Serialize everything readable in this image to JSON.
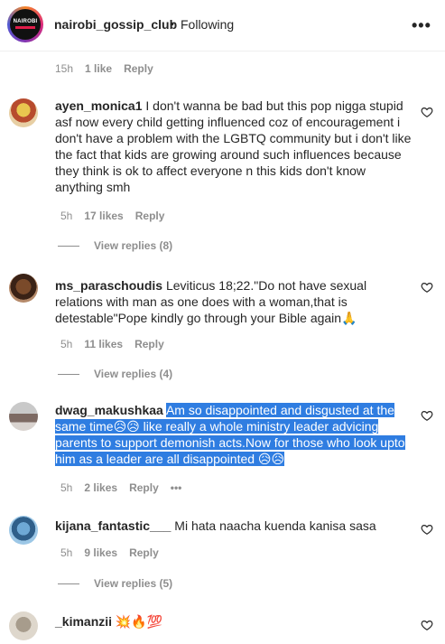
{
  "header": {
    "logo_text": "NAIROBI",
    "username": "nairobi_gossip_club",
    "separator": "•",
    "follow_status": "Following",
    "more": "•••"
  },
  "top_meta": {
    "time": "15h",
    "likes": "1 like",
    "reply": "Reply"
  },
  "comments": [
    {
      "username": "ayen_monica1",
      "text": "I don't wanna be bad but this pop nigga stupid asf now every child getting influenced coz of encouragement i don't have a problem with the LGBTQ community but i don't like the fact that kids are growing around such influences because they think is ok to affect everyone n this kids don't know anything smh",
      "time": "5h",
      "likes": "17 likes",
      "reply": "Reply",
      "view_replies": "View replies (8)"
    },
    {
      "username": "ms_paraschoudis",
      "text": "Leviticus 18;22.\"Do not have sexual relations with man as one does with a woman,that is detestable\"Pope kindly go through your Bible again🙏",
      "time": "5h",
      "likes": "11 likes",
      "reply": "Reply",
      "view_replies": "View replies (4)"
    },
    {
      "username": "dwag_makushkaa",
      "text": "Am so disappointed and disgusted at the same time😥😥 like really a whole ministry leader advicing parents to support demonish acts.Now for those who look upto him as a leader are all disappointed 😥😥",
      "time": "5h",
      "likes": "2 likes",
      "reply": "Reply",
      "more": "•••"
    },
    {
      "username": "kijana_fantastic___",
      "text": "Mi hata naacha kuenda kanisa sasa",
      "time": "5h",
      "likes": "9 likes",
      "reply": "Reply",
      "view_replies": "View replies (5)"
    },
    {
      "username": "_kimanzii",
      "text": "💥🔥💯"
    }
  ],
  "colors": {
    "selection": "#2f7de1",
    "muted": "#8e8e8e",
    "text": "#262626"
  }
}
